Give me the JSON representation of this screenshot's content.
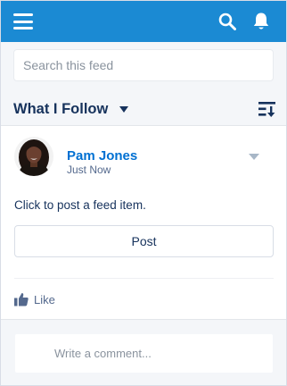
{
  "header": {
    "menu_icon": "hamburger-icon",
    "search_icon": "search-icon",
    "notifications_icon": "bell-icon",
    "background": "#1b8ad3"
  },
  "search": {
    "placeholder": "Search this feed",
    "value": ""
  },
  "filter": {
    "label": "What I Follow",
    "caret_icon": "caret-down-icon",
    "sort_icon": "sort-icon"
  },
  "post": {
    "author": "Pam Jones",
    "timestamp": "Just Now",
    "body": "Click to post a feed item.",
    "post_button_label": "Post",
    "like_label": "Like",
    "like_icon": "thumbs-up-icon",
    "menu_icon": "chevron-down-icon"
  },
  "comment": {
    "placeholder": "Write a comment..."
  },
  "colors": {
    "accent": "#1b8ad3",
    "link": "#0070d2",
    "text": "#16325c",
    "muted": "#54698d"
  }
}
